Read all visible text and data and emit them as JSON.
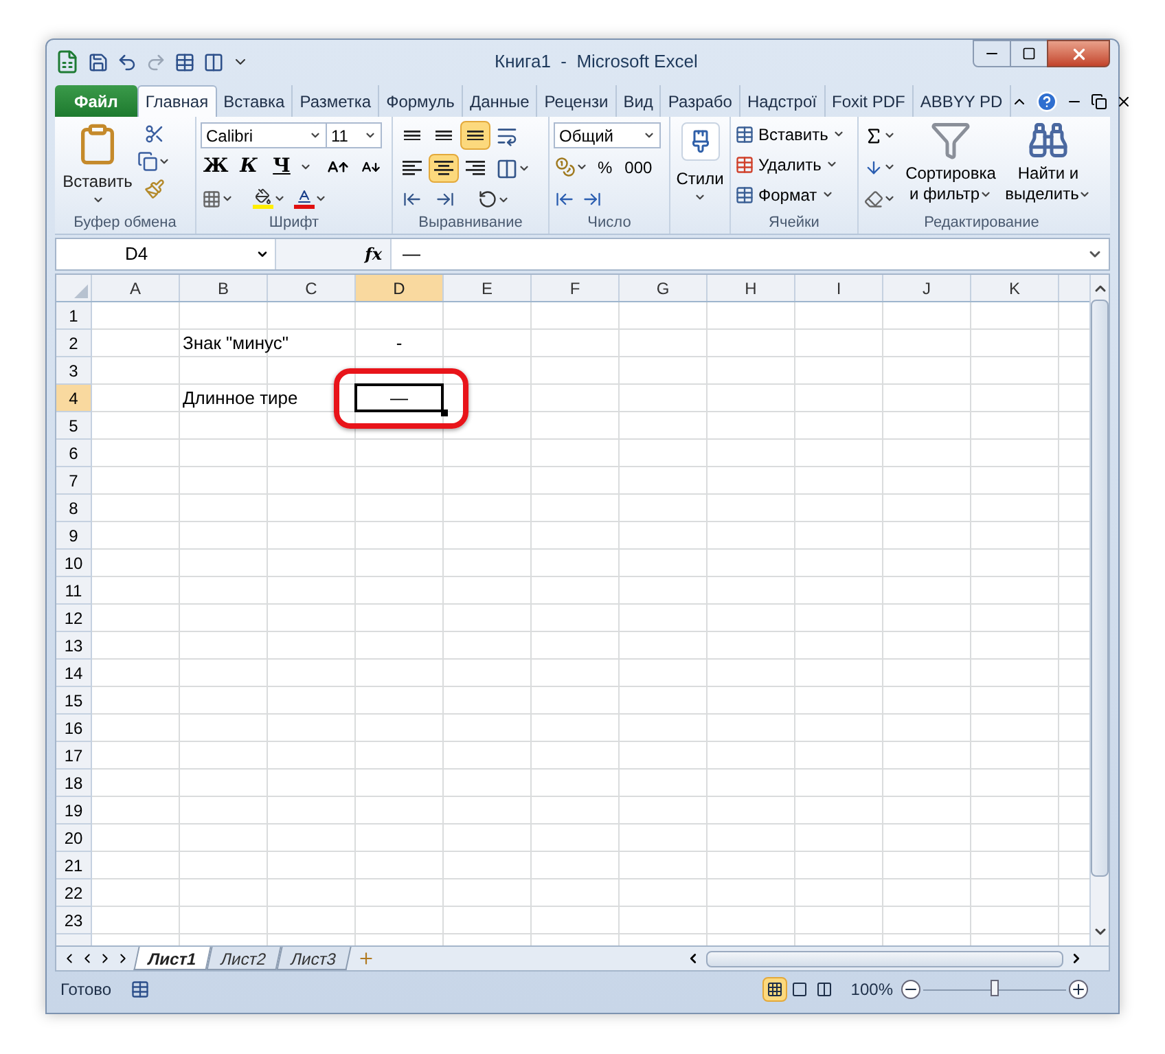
{
  "window": {
    "title": "Книга1  -  Microsoft Excel"
  },
  "file_tab": "Файл",
  "tabs": [
    {
      "label": "Главная",
      "selected": true
    },
    {
      "label": "Вставка",
      "selected": false
    },
    {
      "label": "Разметка",
      "selected": false
    },
    {
      "label": "Формуль",
      "selected": false
    },
    {
      "label": "Данные",
      "selected": false
    },
    {
      "label": "Рецензи",
      "selected": false
    },
    {
      "label": "Вид",
      "selected": false
    },
    {
      "label": "Разрабо",
      "selected": false
    },
    {
      "label": "Надстрої",
      "selected": false
    },
    {
      "label": "Foxit PDF",
      "selected": false
    },
    {
      "label": "ABBYY PD",
      "selected": false
    }
  ],
  "ribbon": {
    "clipboard": {
      "label": "Буфер обмена",
      "paste": "Вставить"
    },
    "font": {
      "label": "Шрифт",
      "font_name": "Calibri",
      "font_size": "11",
      "style_buttons": [
        "Ж",
        "К",
        "Ч"
      ]
    },
    "alignment": {
      "label": "Выравнивание",
      "buttons": [
        {
          "selected": false
        },
        {
          "selected": false
        },
        {
          "selected": true
        },
        {
          "selected": false
        },
        {
          "selected": true
        },
        {
          "selected": false
        }
      ]
    },
    "number": {
      "label": "Число",
      "format": "Общий",
      "buttons": [
        "%",
        "000"
      ]
    },
    "styles": {
      "label": "Стили"
    },
    "cells": {
      "label": "Ячейки",
      "buttons": [
        "Вставить",
        "Удалить",
        "Формат"
      ]
    },
    "editing": {
      "label": "Редактирование",
      "sort": [
        "Сортировка",
        "и фильтр"
      ],
      "find": [
        "Найти и",
        "выделить"
      ]
    }
  },
  "formula_bar": {
    "name_box": "D4",
    "function_label": "fx",
    "value": "—"
  },
  "columns": [
    {
      "label": "A",
      "selected": false
    },
    {
      "label": "B",
      "selected": false
    },
    {
      "label": "C",
      "selected": false
    },
    {
      "label": "D",
      "selected": true
    },
    {
      "label": "E",
      "selected": false
    },
    {
      "label": "F",
      "selected": false
    },
    {
      "label": "G",
      "selected": false
    },
    {
      "label": "H",
      "selected": false
    },
    {
      "label": "I",
      "selected": false
    },
    {
      "label": "J",
      "selected": false
    },
    {
      "label": "K",
      "selected": false
    }
  ],
  "rows": [
    {
      "header": "1",
      "selected": false
    },
    {
      "header": "2",
      "selected": false,
      "cells": [
        null,
        {
          "text": "Знак \"минус\"",
          "kind": "text",
          "selected": false
        },
        null,
        {
          "text": "-",
          "kind": "symbol",
          "selected": false
        }
      ]
    },
    {
      "header": "3",
      "selected": false
    },
    {
      "header": "4",
      "selected": true,
      "cells": [
        null,
        {
          "text": "Длинное тире",
          "kind": "text",
          "selected": false
        },
        null,
        {
          "text": "—",
          "kind": "symbol",
          "selected": true
        }
      ]
    },
    {
      "header": "5",
      "selected": false
    },
    {
      "header": "6",
      "selected": false
    },
    {
      "header": "7",
      "selected": false
    },
    {
      "header": "8",
      "selected": false
    },
    {
      "header": "9",
      "selected": false
    },
    {
      "header": "10",
      "selected": false
    },
    {
      "header": "11",
      "selected": false
    },
    {
      "header": "12",
      "selected": false
    },
    {
      "header": "13",
      "selected": false
    },
    {
      "header": "14",
      "selected": false
    },
    {
      "header": "15",
      "selected": false
    },
    {
      "header": "16",
      "selected": false
    },
    {
      "header": "17",
      "selected": false
    },
    {
      "header": "18",
      "selected": false
    },
    {
      "header": "19",
      "selected": false
    },
    {
      "header": "20",
      "selected": false
    },
    {
      "header": "21",
      "selected": false
    },
    {
      "header": "22",
      "selected": false
    },
    {
      "header": "23",
      "selected": false
    }
  ],
  "sheets": [
    {
      "label": "Лист1",
      "selected": true
    },
    {
      "label": "Лист2",
      "selected": false
    },
    {
      "label": "Лист3",
      "selected": false
    }
  ],
  "status_bar": {
    "text": "Готово",
    "views": [
      {
        "selected": true
      },
      {
        "selected": false
      },
      {
        "selected": false
      }
    ],
    "zoom": "100%",
    "zoom_slider": {
      "level": 0.5
    }
  }
}
